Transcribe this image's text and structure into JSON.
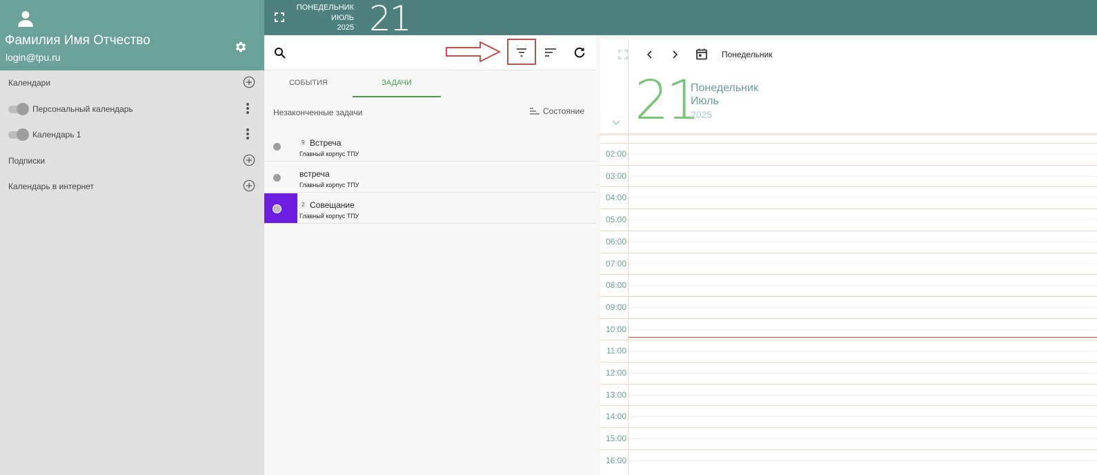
{
  "sidebar": {
    "user_name": "Фамилия Имя Отчество",
    "user_login": "login@tpu.ru",
    "calendars_label": "Календари",
    "calendars": [
      {
        "label": "Персональный календарь"
      },
      {
        "label": "Календарь 1"
      }
    ],
    "subscriptions_label": "Подписки",
    "internet_label": "Календарь в интернет"
  },
  "header": {
    "day_of_week": "ПОНЕДЕЛЬНИК",
    "month": "ИЮЛЬ",
    "year": "2025",
    "day": "21"
  },
  "middle": {
    "tabs": [
      {
        "label": "СОБЫТИЯ"
      },
      {
        "label": "ЗАДАЧИ"
      }
    ],
    "active_tab": "ЗАДАЧИ",
    "section_title": "Незаконченные задачи",
    "state_label": "Состояние",
    "tasks": [
      {
        "badge": "9",
        "title": "Встреча",
        "location": "Главный корпус ТПУ",
        "highlight": false
      },
      {
        "badge": "",
        "title": "встреча",
        "location": "Главный корпус ТПУ",
        "highlight": false
      },
      {
        "badge": "2",
        "title": "Совещание",
        "location": "Главный корпус ТПУ",
        "highlight": true,
        "color": "#6b1de0"
      }
    ]
  },
  "dayview": {
    "view_label": "Понедельник",
    "day": "21",
    "day_of_week": "Понедельник",
    "month": "Июль",
    "year": "2025",
    "hours": [
      "02:00",
      "03:00",
      "04:00",
      "05:00",
      "06:00",
      "07:00",
      "08:00",
      "09:00",
      "10:00",
      "11:00",
      "12:00",
      "13:00",
      "14:00",
      "15:00",
      "16:00"
    ],
    "current_time": "10:52"
  },
  "colors": {
    "profile_bg": "#6aa29a",
    "topbar_bg": "#4e8080",
    "accent_green": "#43a047",
    "day_number_green": "#7cc47a",
    "now_line": "#e53935",
    "annotation_red": "#c0504d"
  }
}
